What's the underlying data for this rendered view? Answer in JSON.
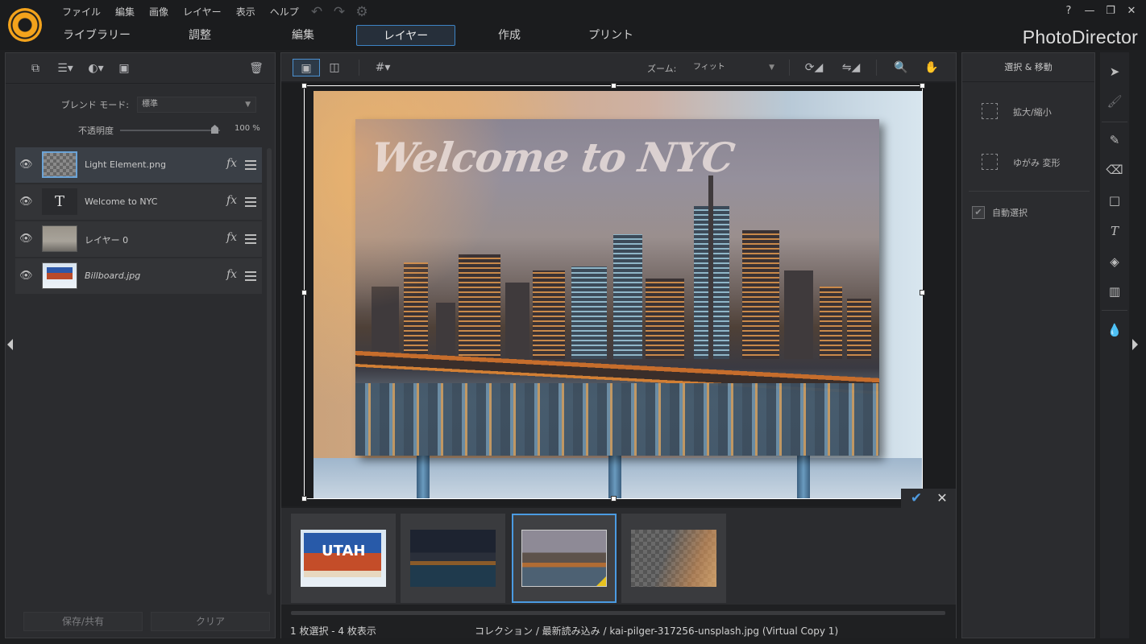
{
  "app": {
    "title": "PhotoDirector"
  },
  "menu": [
    "ファイル",
    "編集",
    "画像",
    "レイヤー",
    "表示",
    "ヘルプ"
  ],
  "window_controls": [
    "?",
    "—",
    "❐",
    "✕"
  ],
  "modes": [
    {
      "label": "ライブラリー",
      "active": false
    },
    {
      "label": "調整",
      "active": false
    },
    {
      "label": "編集",
      "active": false
    },
    {
      "label": "レイヤー",
      "active": true
    },
    {
      "label": "作成",
      "active": false
    },
    {
      "label": "プリント",
      "active": false
    }
  ],
  "layers_panel": {
    "blend_label": "ブレンド モード:",
    "blend_value": "標準",
    "opacity_label": "不透明度",
    "opacity_value": "100 %",
    "opacity": 1.0,
    "save_share": "保存/共有",
    "clear": "クリア",
    "layers": [
      {
        "name": "Light Element.png",
        "selected": true,
        "italic": false
      },
      {
        "name": "Welcome to NYC",
        "selected": false,
        "italic": false,
        "thumb_text": "T"
      },
      {
        "name": "レイヤー 0",
        "selected": false,
        "italic": false
      },
      {
        "name": "Billboard.jpg",
        "selected": false,
        "italic": true
      }
    ],
    "fx_label": "fx"
  },
  "center": {
    "zoom_label": "ズーム:",
    "zoom_value": "フィット",
    "billboard_text": "Welcome to NYC",
    "filmstrip_utah_text": "UTAH",
    "status_count": "1 枚選択 - 4 枚表示",
    "status_path": "コレクション / 最新読み込み / kai-pilger-317256-unsplash.jpg (Virtual Copy 1)"
  },
  "right_panel": {
    "title": "選択 & 移動",
    "scale": "拡大/縮小",
    "distort": "ゆがみ 変形",
    "auto_select": "自動選択",
    "auto_select_checked": true
  },
  "colors": {
    "accent": "#4b9be2",
    "logo": "#f3a31c",
    "background": "#1e1f21",
    "panel": "#2b2c2f"
  },
  "icons": [
    "undo-icon",
    "redo-icon",
    "settings-icon",
    "eye-icon",
    "fx-icon",
    "adjust-icon",
    "grid-icon",
    "rotate-icon",
    "flip-icon",
    "zoom-icon",
    "hand-icon",
    "select-arrow-icon",
    "brush-icon",
    "eraser-icon",
    "rectangle-icon",
    "text-icon",
    "fill-icon",
    "gradient-icon",
    "blur-icon",
    "checkmark-icon",
    "close-icon",
    "trash-icon"
  ]
}
